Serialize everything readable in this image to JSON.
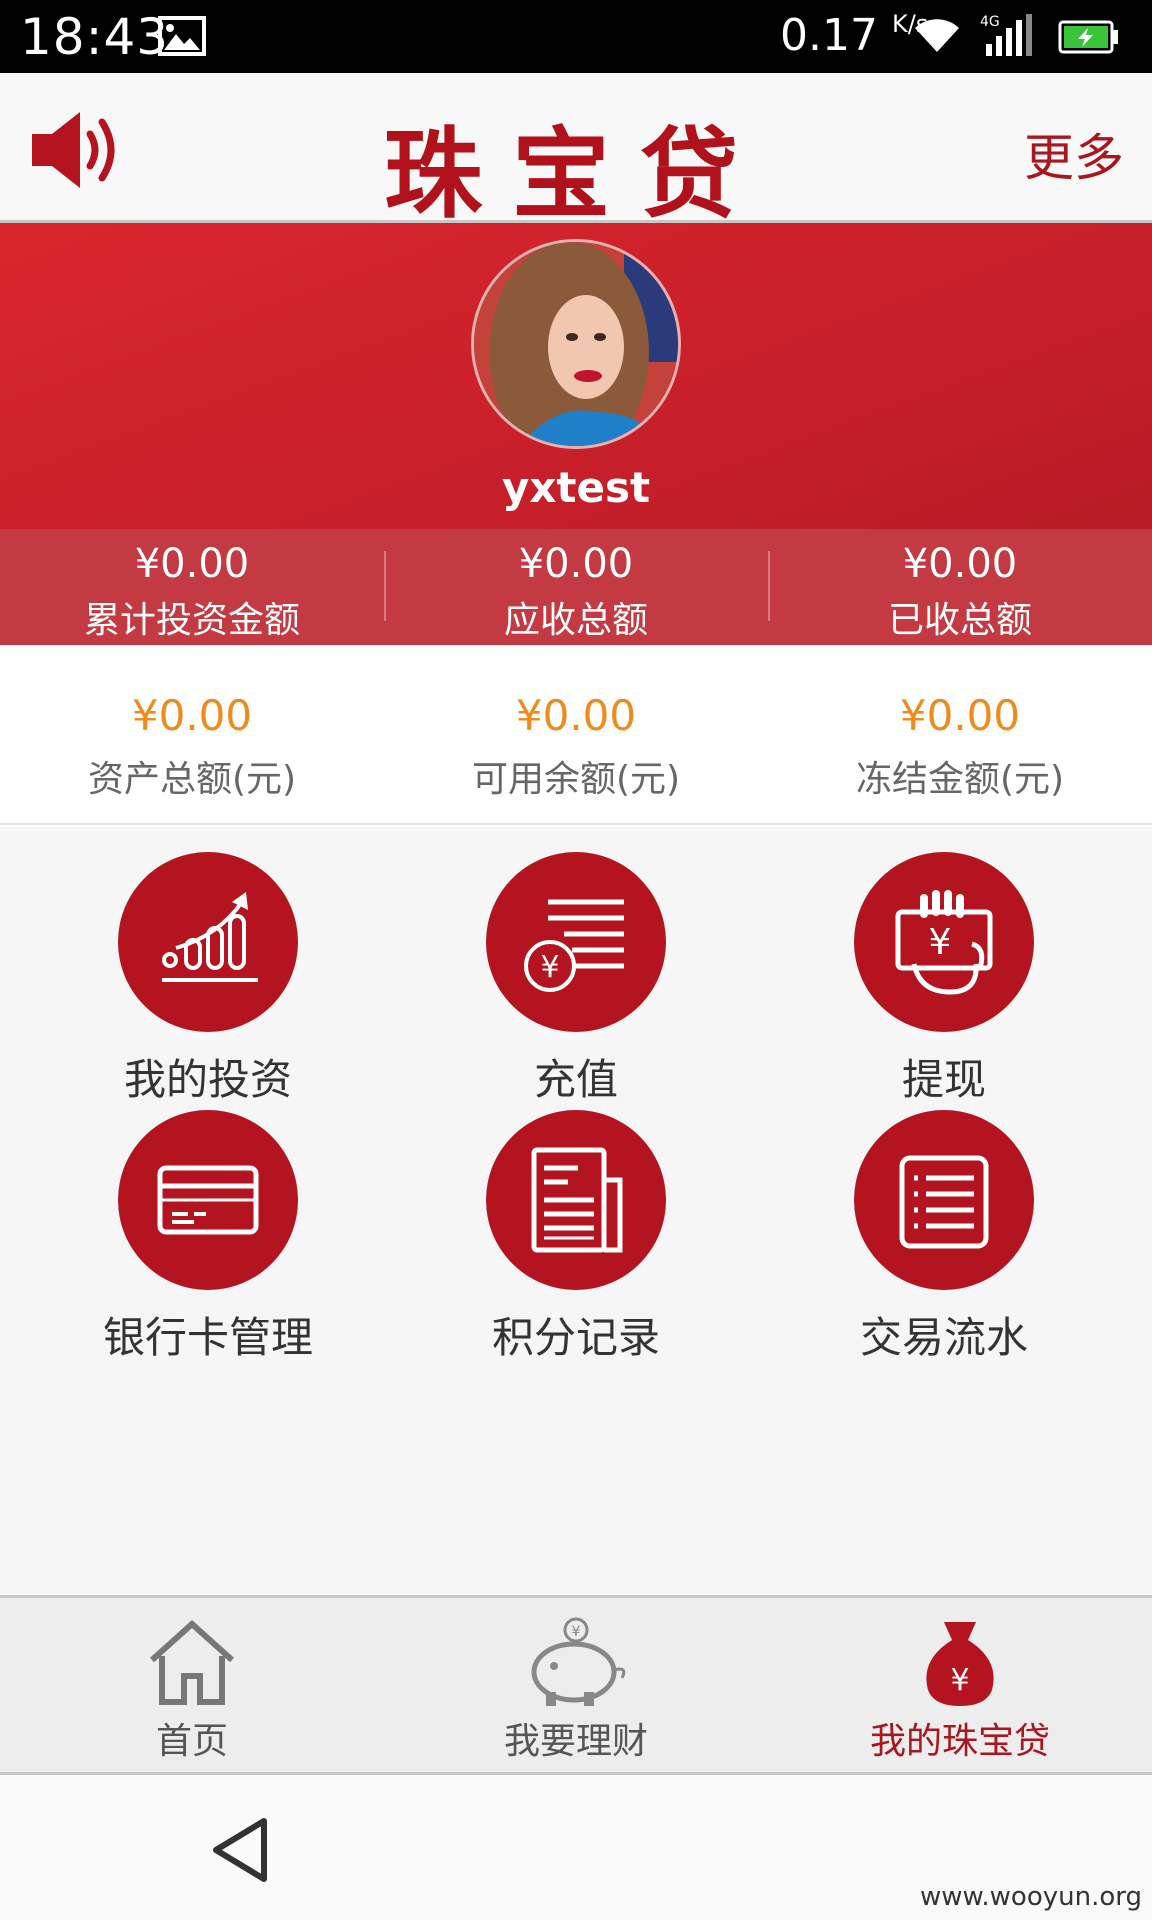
{
  "status_bar": {
    "time": "18:43",
    "speed": "0.17",
    "speed_unit": "K/s",
    "network": "4G"
  },
  "header": {
    "title": "珠宝贷",
    "more_label": "更多"
  },
  "profile": {
    "username": "yxtest"
  },
  "stats": [
    {
      "value": "¥0.00",
      "label": "累计投资金额"
    },
    {
      "value": "¥0.00",
      "label": "应收总额"
    },
    {
      "value": "¥0.00",
      "label": "已收总额"
    }
  ],
  "balances": [
    {
      "value": "¥0.00",
      "label": "资产总额(元)"
    },
    {
      "value": "¥0.00",
      "label": "可用余额(元)"
    },
    {
      "value": "¥0.00",
      "label": "冻结金额(元)"
    }
  ],
  "menu": [
    {
      "label": "我的投资",
      "icon": "growth-chart-icon"
    },
    {
      "label": "充值",
      "icon": "recharge-coin-icon"
    },
    {
      "label": "提现",
      "icon": "withdraw-hand-icon"
    },
    {
      "label": "银行卡管理",
      "icon": "bank-card-icon"
    },
    {
      "label": "积分记录",
      "icon": "points-document-icon"
    },
    {
      "label": "交易流水",
      "icon": "transaction-list-icon"
    }
  ],
  "tabs": [
    {
      "label": "首页",
      "icon": "home-icon",
      "active": false
    },
    {
      "label": "我要理财",
      "icon": "piggy-bank-icon",
      "active": false
    },
    {
      "label": "我的珠宝贷",
      "icon": "money-bag-icon",
      "active": true
    }
  ],
  "watermark": "www.wooyun.org",
  "colors": {
    "brand_red": "#b3141f",
    "banner_red": "#d9262d",
    "stats_row": "#c43a42",
    "balance_orange": "#f08a1c"
  }
}
